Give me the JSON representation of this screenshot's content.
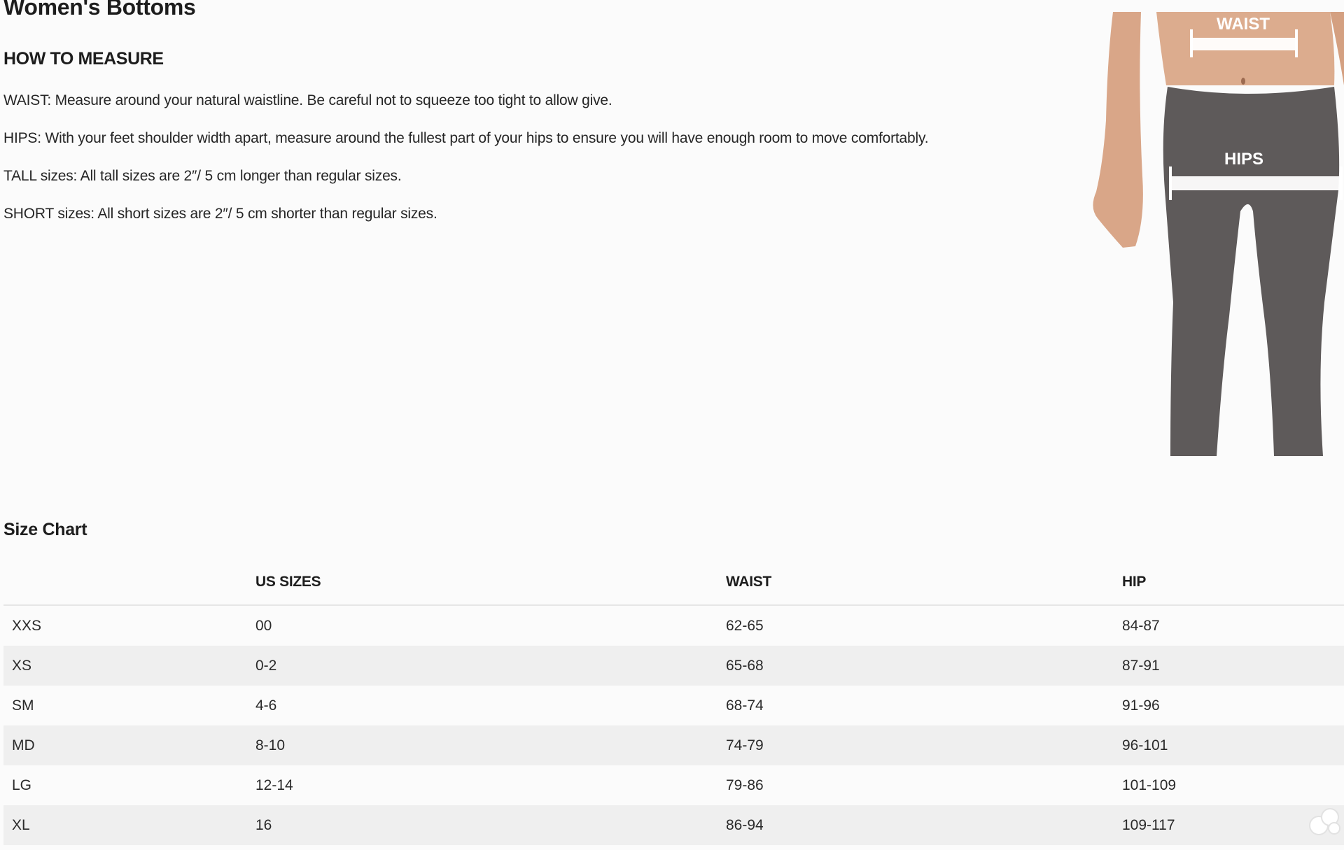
{
  "page": {
    "title": "Women's Bottoms"
  },
  "measure": {
    "heading": "HOW TO MEASURE",
    "instructions": [
      "WAIST: Measure around your natural waistline. Be careful not to squeeze too tight to allow give.",
      "HIPS: With your feet shoulder width apart, measure around the fullest part of your hips to ensure you will have enough room to move comfortably.",
      "TALL sizes: All tall sizes are 2″/ 5 cm longer than regular sizes.",
      "SHORT sizes: All short sizes are 2″/ 5 cm shorter than regular sizes."
    ]
  },
  "illustration": {
    "waist_label": "WAIST",
    "hips_label": "HIPS",
    "legging_color": "#5e5a5a",
    "skin_color": "#d9a688",
    "band_color": "#ffffff"
  },
  "size_chart": {
    "title": "Size Chart",
    "headers": [
      "",
      "US SIZES",
      "WAIST",
      "HIP"
    ],
    "rows": [
      [
        "XXS",
        "00",
        "62-65",
        "84-87"
      ],
      [
        "XS",
        "0-2",
        "65-68",
        "87-91"
      ],
      [
        "SM",
        "4-6",
        "68-74",
        "91-96"
      ],
      [
        "MD",
        "8-10",
        "74-79",
        "96-101"
      ],
      [
        "LG",
        "12-14",
        "79-86",
        "101-109"
      ],
      [
        "XL",
        "16",
        "86-94",
        "109-117"
      ]
    ],
    "stripe_color": "#efefef"
  }
}
